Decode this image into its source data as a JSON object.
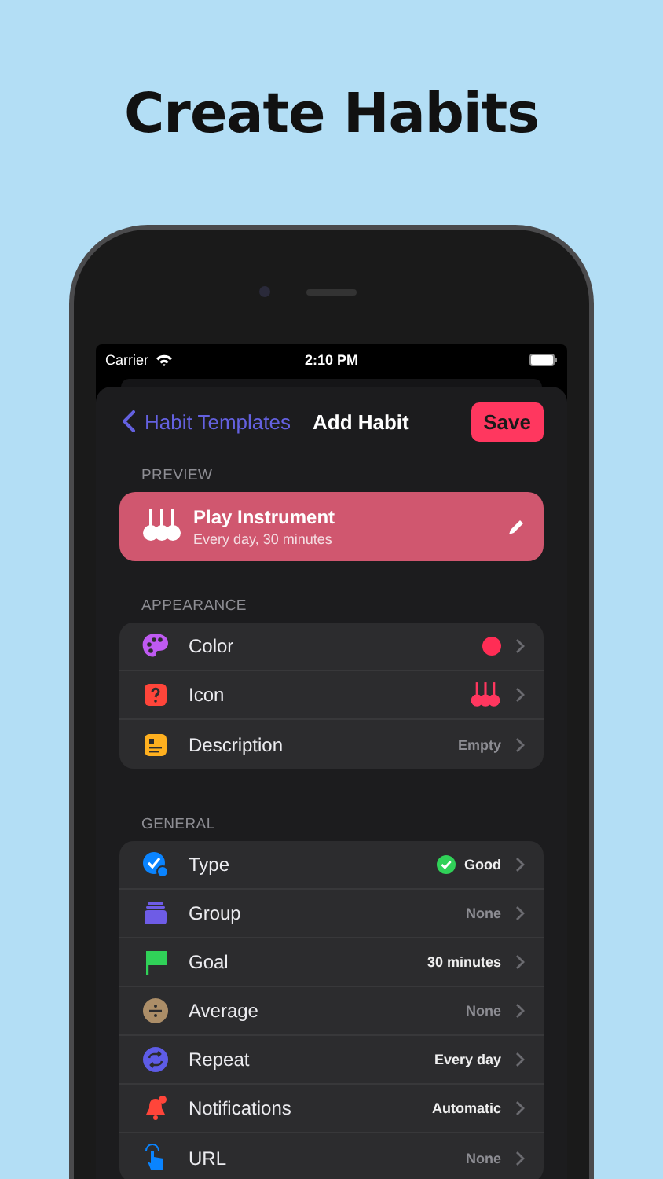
{
  "headline": "Create Habits",
  "status_bar": {
    "carrier": "Carrier",
    "time": "2:10 PM"
  },
  "nav": {
    "back": "Habit Templates",
    "title": "Add Habit",
    "action": "Save"
  },
  "preview": {
    "label": "PREVIEW",
    "name": "Play Instrument",
    "subtitle": "Every day, 30 minutes"
  },
  "sections": [
    {
      "title": "APPEARANCE",
      "rows": [
        {
          "label": "Color",
          "kind": "color",
          "color": "#ff2d55"
        },
        {
          "label": "Icon",
          "kind": "glyph"
        },
        {
          "label": "Description",
          "kind": "text",
          "value": "Empty",
          "dim": true
        }
      ]
    },
    {
      "title": "GENERAL",
      "rows": [
        {
          "label": "Type",
          "kind": "status",
          "value": "Good",
          "dim": false
        },
        {
          "label": "Group",
          "kind": "text",
          "value": "None",
          "dim": true
        },
        {
          "label": "Goal",
          "kind": "text",
          "value": "30 minutes",
          "dim": false
        },
        {
          "label": "Average",
          "kind": "text",
          "value": "None",
          "dim": true
        },
        {
          "label": "Repeat",
          "kind": "text",
          "value": "Every day",
          "dim": false
        },
        {
          "label": "Notifications",
          "kind": "text",
          "value": "Automatic",
          "dim": false
        },
        {
          "label": "URL",
          "kind": "text",
          "value": "None",
          "dim": true
        }
      ]
    }
  ]
}
